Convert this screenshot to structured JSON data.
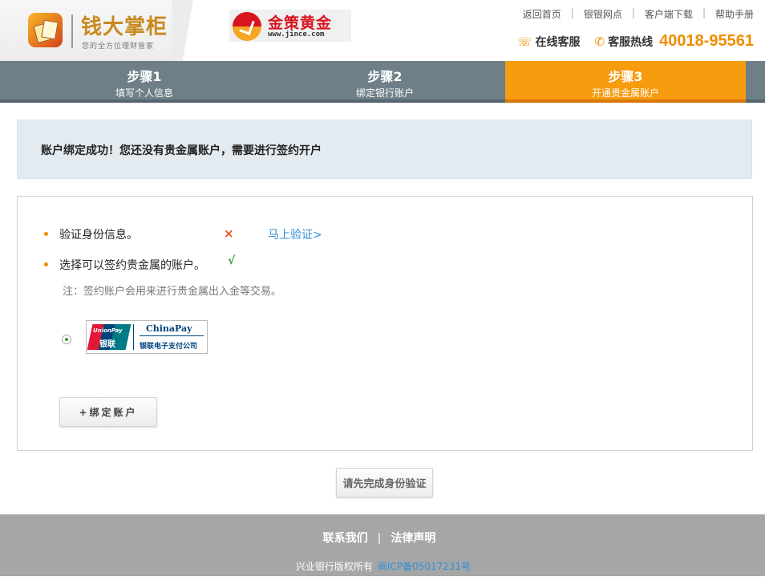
{
  "header": {
    "app_name": "钱大掌柜",
    "app_slogan": "您的全方位理财管家",
    "partner_name": "金策黄金",
    "partner_url": "www.jince.com",
    "top_links": [
      "返回首页",
      "银银网点",
      "客户端下载",
      "帮助手册"
    ],
    "link_separator": "|",
    "online_service": "在线客服",
    "hotline_label": "客服热线",
    "hotline_number": "40018-95561"
  },
  "steps": [
    {
      "title": "步骤1",
      "desc": "填写个人信息"
    },
    {
      "title": "步骤2",
      "desc": "绑定银行账户"
    },
    {
      "title": "步骤3",
      "desc": "开通贵金属账户"
    }
  ],
  "notice": "账户绑定成功！您还没有贵金属账户，需要进行签约开户",
  "checklist": {
    "identity": {
      "text": "验证身份信息。",
      "status_icon": "×",
      "link": "马上验证>"
    },
    "account": {
      "text": "选择可以签约贵金属的账户。",
      "status_icon": "√"
    },
    "note": "注：签约账户会用来进行贵金属出入金等交易。"
  },
  "bank_card": {
    "logo_en": "UnionPay",
    "logo_cn": "银联",
    "name_en": "ChinaPay",
    "name_cn": "银联电子支付公司"
  },
  "bind_button": "+绑定账户",
  "submit_button": "请先完成身份验证",
  "footer": {
    "links": [
      "联系我们",
      "法律声明"
    ],
    "separator": "|",
    "copyright": "兴业银行版权所有",
    "icp": "闽ICP备05017231号"
  },
  "colors": {
    "accent": "#f79b0f",
    "steps_bar": "#6e7f88",
    "link": "#2e8fd8",
    "footer": "#a6a6a6"
  }
}
